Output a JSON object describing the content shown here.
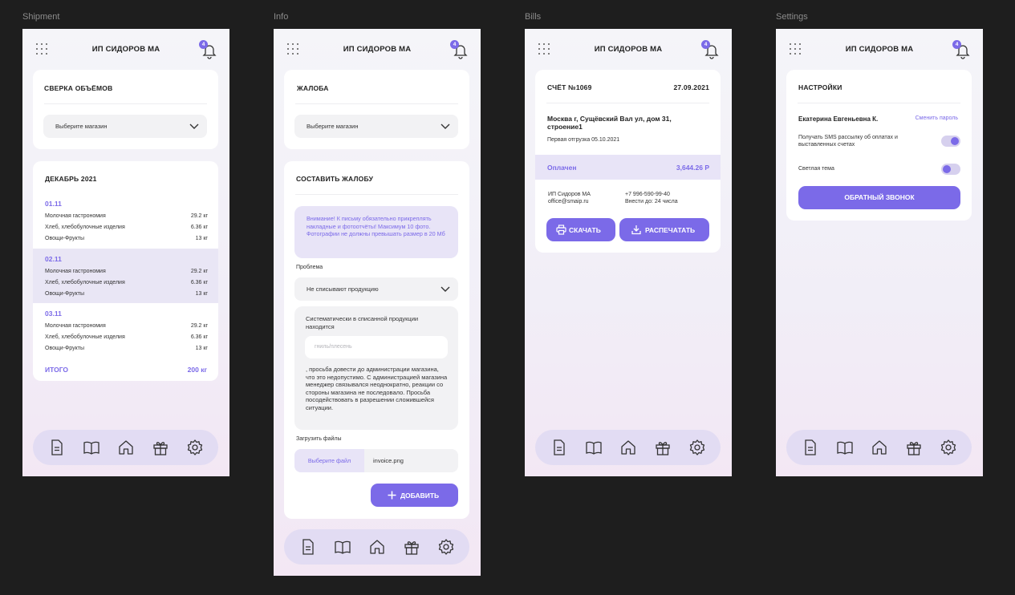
{
  "frames": {
    "shipment": {
      "label": "Shipment",
      "header_title": "ИП СИДОРОВ МА",
      "notifications": "4",
      "reconcile": {
        "title": "СВЕРКА ОБЪЁМОВ",
        "select_placeholder": "Выберите магазин"
      },
      "month": {
        "title": "ДЕКАБРЬ 2021",
        "days": [
          {
            "date": "01.11",
            "items": [
              {
                "name": "Молочная гастрономия",
                "qty": "29.2 кг"
              },
              {
                "name": "Хлеб, хлебобулочные изделия",
                "qty": "6.36 кг"
              },
              {
                "name": "Овощи-Фрукты",
                "qty": "13 кг"
              }
            ]
          },
          {
            "date": "02.11",
            "items": [
              {
                "name": "Молочная гастрономия",
                "qty": "29.2 кг"
              },
              {
                "name": "Хлеб, хлебобулочные изделия",
                "qty": "6.36 кг"
              },
              {
                "name": "Овощи-Фрукты",
                "qty": "13 кг"
              }
            ]
          },
          {
            "date": "03.11",
            "items": [
              {
                "name": "Молочная гастрономия",
                "qty": "29.2 кг"
              },
              {
                "name": "Хлеб, хлебобулочные изделия",
                "qty": "6.36 кг"
              },
              {
                "name": "Овощи-Фрукты",
                "qty": "13 кг"
              }
            ]
          }
        ],
        "total_label": "ИТОГО",
        "total_value": "200 кг"
      }
    },
    "info": {
      "label": "Info",
      "header_title": "ИП СИДОРОВ МА",
      "notifications": "4",
      "complaint": {
        "title": "ЖАЛОБА",
        "select_placeholder": "Выберите магазин"
      },
      "compose": {
        "title": "СОСТАВИТЬ ЖАЛОБУ",
        "notice": "Внимание! К письму обязательно прикреплять накладные и фотоотчёты! Максимум 10 фото. Фотографии не должны превышать размер в 20 Мб",
        "problem_label": "Проблема",
        "problem_value": "Не списывают продукцию",
        "text_before": "Систематически в списанной продукции находится",
        "input_placeholder": "гниль/плесень",
        "text_after": ", просьба довести до администрации магазина, что это недопустимо. С администрацией магазина менеджер связывался неоднократно, реакции со стороны магазина не последовало. Просьба посодействовать в разрешении сложившейся ситуации.",
        "upload_label": "Загрузить файлы",
        "choose_file": "Выберите файл",
        "file_name": "invoice.png",
        "add_button": "ДОБАВИТЬ"
      }
    },
    "bills": {
      "label": "Bills",
      "header_title": "ИП СИДОРОВ МА",
      "notifications": "4",
      "invoice": {
        "number": "СЧЁТ №1069",
        "date": "27.09.2021",
        "address": "Москва г, Сущёвский Вал ул, дом 31, строение1",
        "first_shipment": "Первая отгрузка 05.10.2021",
        "status": "Оплачен",
        "amount": "3,644.26 Р",
        "company": "ИП Сидоров МА",
        "email": "office@smaip.ru",
        "phone": "+7 996-590-99-40",
        "due": "Внести до: 24 числа",
        "download": "СКАЧАТЬ",
        "print": "РАСПЕЧАТАТЬ"
      }
    },
    "settings": {
      "label": "Settings",
      "header_title": "ИП СИДОРОВ МА",
      "notifications": "4",
      "panel": {
        "title": "НАСТРОЙКИ",
        "user": "Екатерина Евгеньевна К.",
        "change_password": "Сменить пароль",
        "sms_label": "Получать SMS рассылку об оплатах и выставленных счетах",
        "sms_on": true,
        "light_label": "Светлая тема",
        "light_on": false,
        "callback": "ОБРАТНЫЙ ЗВОНОК"
      }
    }
  },
  "nav_icons": [
    "document-icon",
    "book-icon",
    "home-icon",
    "gift-icon",
    "settings-gear-icon"
  ],
  "colors": {
    "accent": "#7b6ae8",
    "nav_bg": "#e2dcf3",
    "canvas": "#1e1e1e"
  }
}
